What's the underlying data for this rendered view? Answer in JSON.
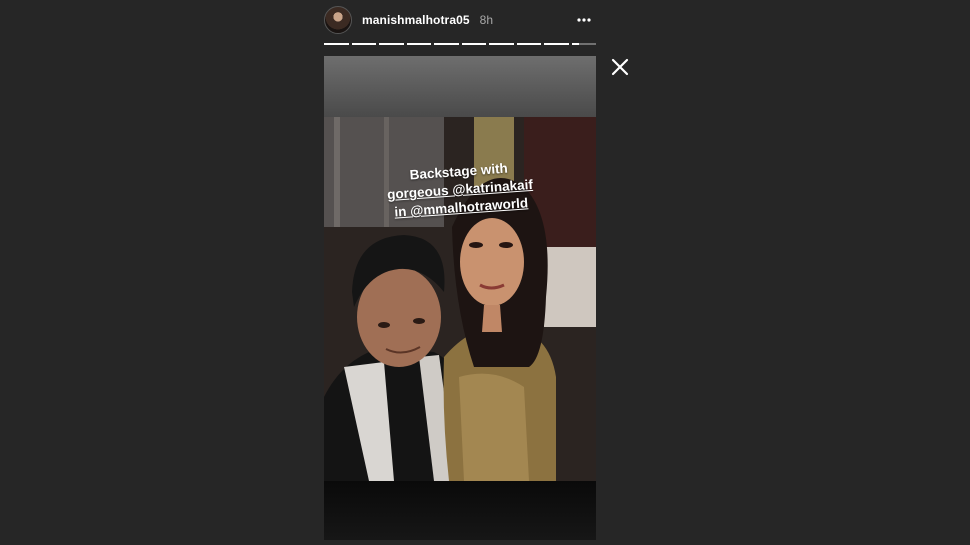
{
  "header": {
    "username": "manishmalhotra05",
    "time": "8h",
    "avatar_icon": "user-avatar"
  },
  "progress": {
    "segment_count": 10,
    "completed_segments": 9,
    "current_fraction": 0.3
  },
  "story": {
    "caption_lines": [
      "Backstage with",
      "gorgeous @katrinakaif",
      "in @mmalhotraworld"
    ],
    "photo_description": "selfie of two people backstage"
  },
  "icons": {
    "more": "more-options-icon",
    "close": "close-icon"
  },
  "colors": {
    "background": "#262626",
    "text": "#ffffff",
    "muted": "#a8a8a8"
  }
}
